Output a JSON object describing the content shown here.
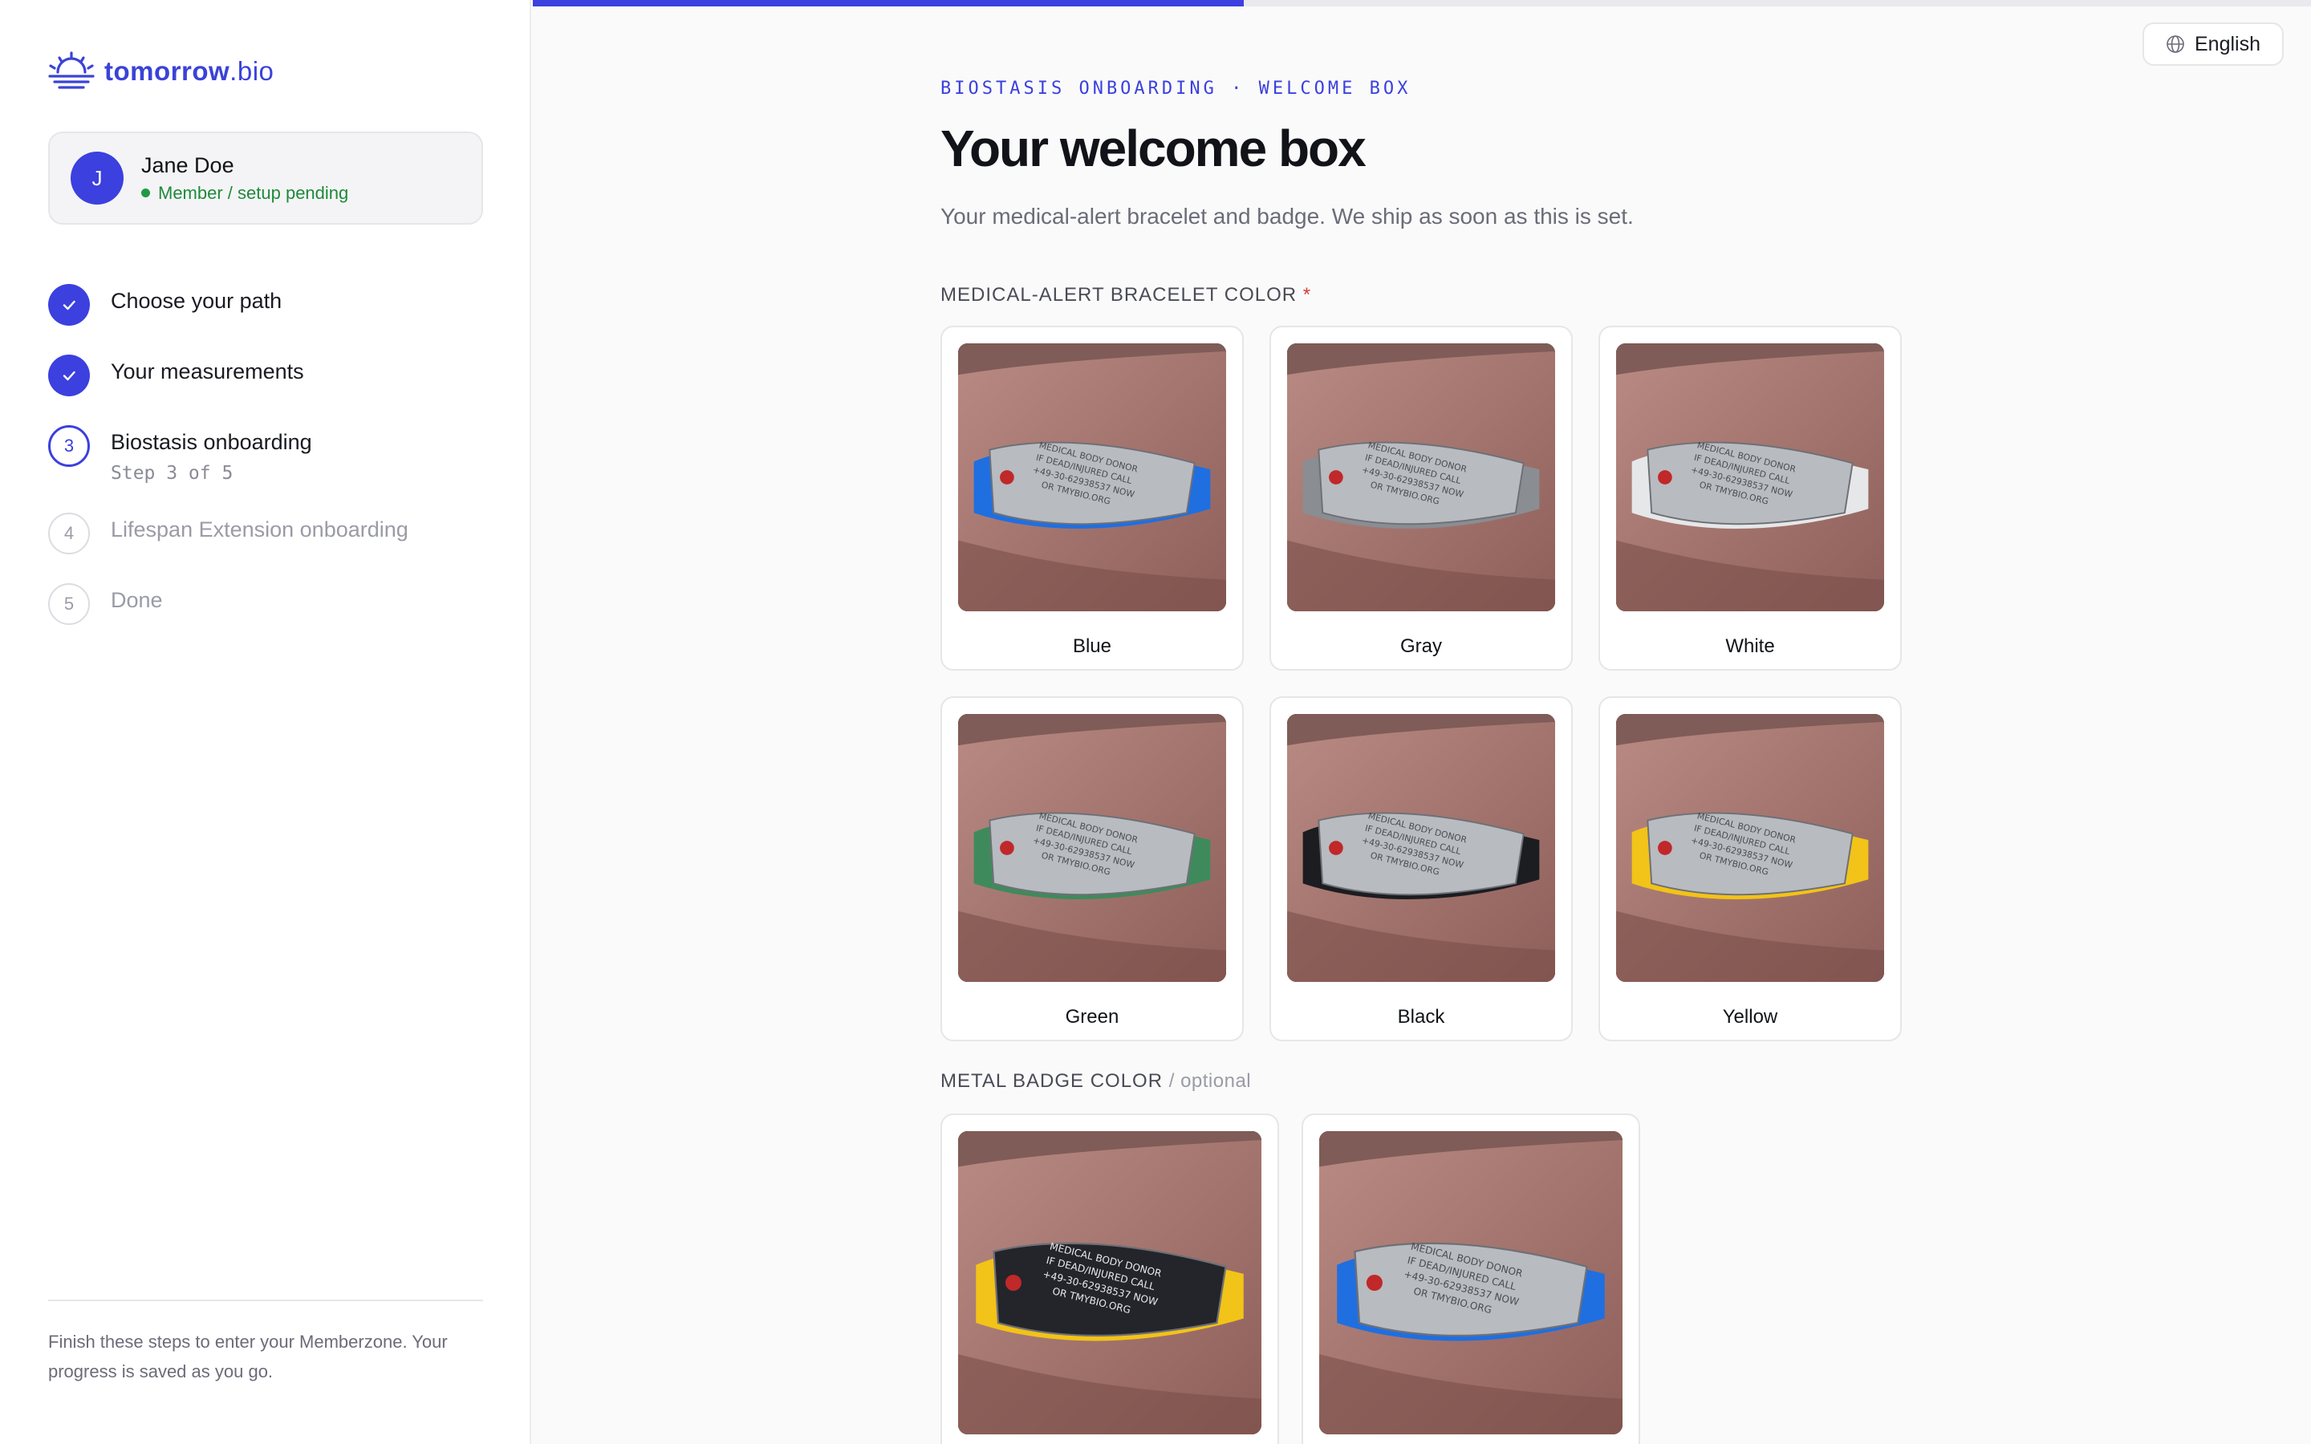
{
  "app": {
    "logo_bold": "tomorrow",
    "logo_light": ".bio"
  },
  "user": {
    "initial": "J",
    "name": "Jane Doe",
    "status": "Member / setup pending"
  },
  "steps": [
    {
      "number": "1",
      "label": "Choose your path",
      "state": "done"
    },
    {
      "number": "2",
      "label": "Your measurements",
      "state": "done"
    },
    {
      "number": "3",
      "label": "Biostasis onboarding",
      "sub": "Step 3 of 5",
      "state": "current"
    },
    {
      "number": "4",
      "label": "Lifespan Extension onboarding",
      "state": "todo"
    },
    {
      "number": "5",
      "label": "Done",
      "state": "todo"
    }
  ],
  "sidebar_note": "Finish these steps to enter your Memberzone. Your progress is saved as you go.",
  "progress": 0.4,
  "language": "English",
  "page": {
    "eyebrow": "BIOSTASIS ONBOARDING · WELCOME BOX",
    "title": "Your welcome box",
    "subtitle": "Your medical-alert bracelet and badge. We ship as soon as this is set."
  },
  "bracelet": {
    "label": "MEDICAL-ALERT BRACELET COLOR",
    "required_mark": "*",
    "options": [
      {
        "label": "Blue",
        "color": "#1f6fe0"
      },
      {
        "label": "Gray",
        "color": "#8a8d92"
      },
      {
        "label": "White",
        "color": "#e6e7e9"
      },
      {
        "label": "Green",
        "color": "#3f8a5c"
      },
      {
        "label": "Black",
        "color": "#1c1d20"
      },
      {
        "label": "Yellow",
        "color": "#f2c318"
      }
    ]
  },
  "badge": {
    "label": "METAL BADGE COLOR",
    "optional_text": "/ optional",
    "options": [
      {
        "plate": "#23252a",
        "band": "#f2c318"
      },
      {
        "plate": "#b8bbc0",
        "band": "#1f6fe0"
      }
    ]
  },
  "colors": {
    "accent": "#3b40df",
    "success": "#1f8a3a",
    "required": "#d93b3b"
  }
}
